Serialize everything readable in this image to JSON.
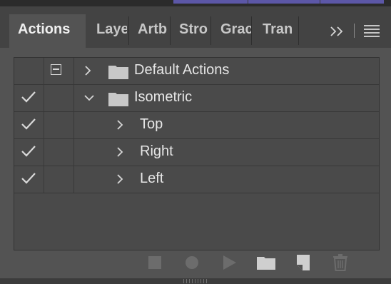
{
  "tabs": [
    {
      "label": "Actions",
      "active": true
    },
    {
      "label": "Laye",
      "active": false
    },
    {
      "label": "Artb",
      "active": false
    },
    {
      "label": "Stro",
      "active": false
    },
    {
      "label": "Grac",
      "active": false
    },
    {
      "label": "Tran",
      "active": false
    }
  ],
  "tab_overflow_label": "»",
  "actions_list": [
    {
      "label": "Default Actions",
      "type": "set",
      "expanded": false,
      "checked": false,
      "dialog_toggle": true
    },
    {
      "label": "Isometric",
      "type": "set",
      "expanded": true,
      "checked": true,
      "dialog_toggle": false
    },
    {
      "label": "Top",
      "type": "action",
      "expanded": false,
      "checked": true,
      "dialog_toggle": false
    },
    {
      "label": "Right",
      "type": "action",
      "expanded": false,
      "checked": true,
      "dialog_toggle": false
    },
    {
      "label": "Left",
      "type": "action",
      "expanded": false,
      "checked": true,
      "dialog_toggle": false
    }
  ],
  "bottom_toolbar": [
    {
      "icon": "stop-icon",
      "enabled": false
    },
    {
      "icon": "record-icon",
      "enabled": false
    },
    {
      "icon": "play-icon",
      "enabled": false
    },
    {
      "icon": "new-set-folder-icon",
      "enabled": true
    },
    {
      "icon": "new-action-icon",
      "enabled": true
    },
    {
      "icon": "trash-icon",
      "enabled": false
    }
  ],
  "colors": {
    "panel_bg": "#535353",
    "tabbar_bg": "#434343",
    "list_bg": "#4a4a4a",
    "accent_strip": "#5c57a7",
    "text": "#e6e6e6"
  }
}
